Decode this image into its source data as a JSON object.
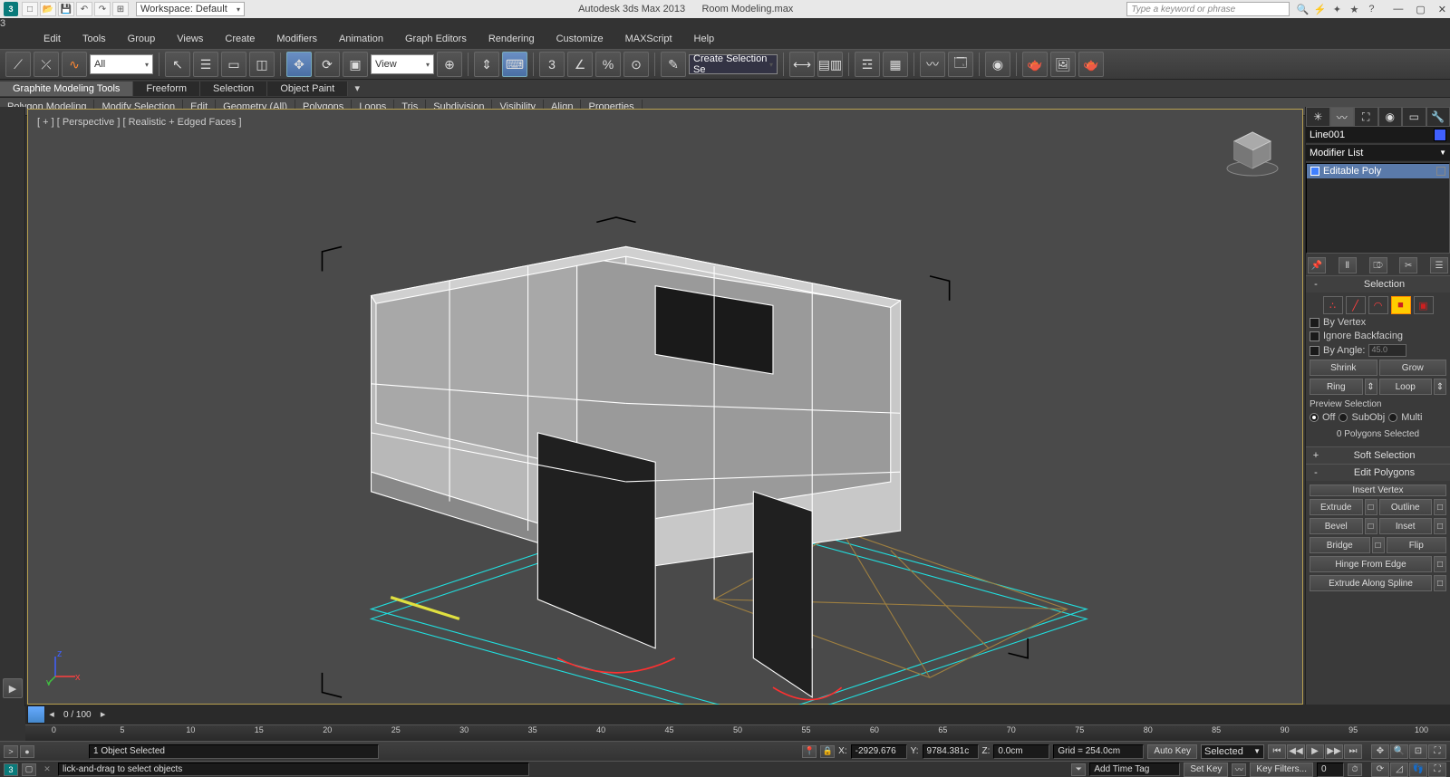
{
  "title": {
    "app": "Autodesk 3ds Max  2013",
    "file": "Room Modeling.max",
    "workspace_label": "Workspace: Default",
    "search_placeholder": "Type a keyword or phrase"
  },
  "menu": [
    "Edit",
    "Tools",
    "Group",
    "Views",
    "Create",
    "Modifiers",
    "Animation",
    "Graph Editors",
    "Rendering",
    "Customize",
    "MAXScript",
    "Help"
  ],
  "maintb": {
    "sel_filter": "All",
    "named_sel": "Create Selection Se",
    "ref_combo": "View"
  },
  "ribbon": {
    "tabs": [
      "Graphite Modeling Tools",
      "Freeform",
      "Selection",
      "Object Paint"
    ],
    "active_tab": 0,
    "subs": [
      "Polygon Modeling",
      "Modify Selection",
      "Edit",
      "Geometry (All)",
      "Polygons",
      "Loops",
      "Tris",
      "Subdivision",
      "Visibility",
      "Align",
      "Properties"
    ]
  },
  "viewport": {
    "label": "[ + ] [ Perspective ] [ Realistic + Edged Faces ]"
  },
  "cmd": {
    "obj_name": "Line001",
    "mod_list": "Modifier List",
    "stack_item": "Editable Poly",
    "selection": {
      "title": "Selection",
      "by_vertex": "By Vertex",
      "ignore_backfacing": "Ignore Backfacing",
      "by_angle": "By Angle:",
      "angle_val": "45.0",
      "shrink": "Shrink",
      "grow": "Grow",
      "ring": "Ring",
      "loop": "Loop",
      "preview": "Preview Selection",
      "off": "Off",
      "subobj": "SubObj",
      "multi": "Multi",
      "status": "0 Polygons Selected"
    },
    "soft_sel": "Soft Selection",
    "edit_poly": {
      "title": "Edit Polygons",
      "insert_vertex": "Insert Vertex",
      "extrude": "Extrude",
      "outline": "Outline",
      "bevel": "Bevel",
      "inset": "Inset",
      "bridge": "Bridge",
      "flip": "Flip",
      "hinge": "Hinge From Edge",
      "extrude_spline": "Extrude Along Spline"
    }
  },
  "timeline": {
    "range": "0 / 100",
    "ticks": [
      0,
      5,
      10,
      15,
      20,
      25,
      30,
      35,
      40,
      45,
      50,
      55,
      60,
      65,
      70,
      75,
      80,
      85,
      90,
      95,
      100
    ]
  },
  "status": {
    "selected": "1 Object Selected",
    "x_label": "X:",
    "x": "-2929.676",
    "y_label": "Y:",
    "y": "9784.381c",
    "z_label": "Z:",
    "z": "0.0cm",
    "grid": "Grid = 254.0cm",
    "auto_key": "Auto Key",
    "set_key": "Set Key",
    "selected_combo": "Selected",
    "key_filters": "Key Filters...",
    "add_time_tag": "Add Time Tag",
    "prompt": "lick-and-drag to select objects"
  }
}
